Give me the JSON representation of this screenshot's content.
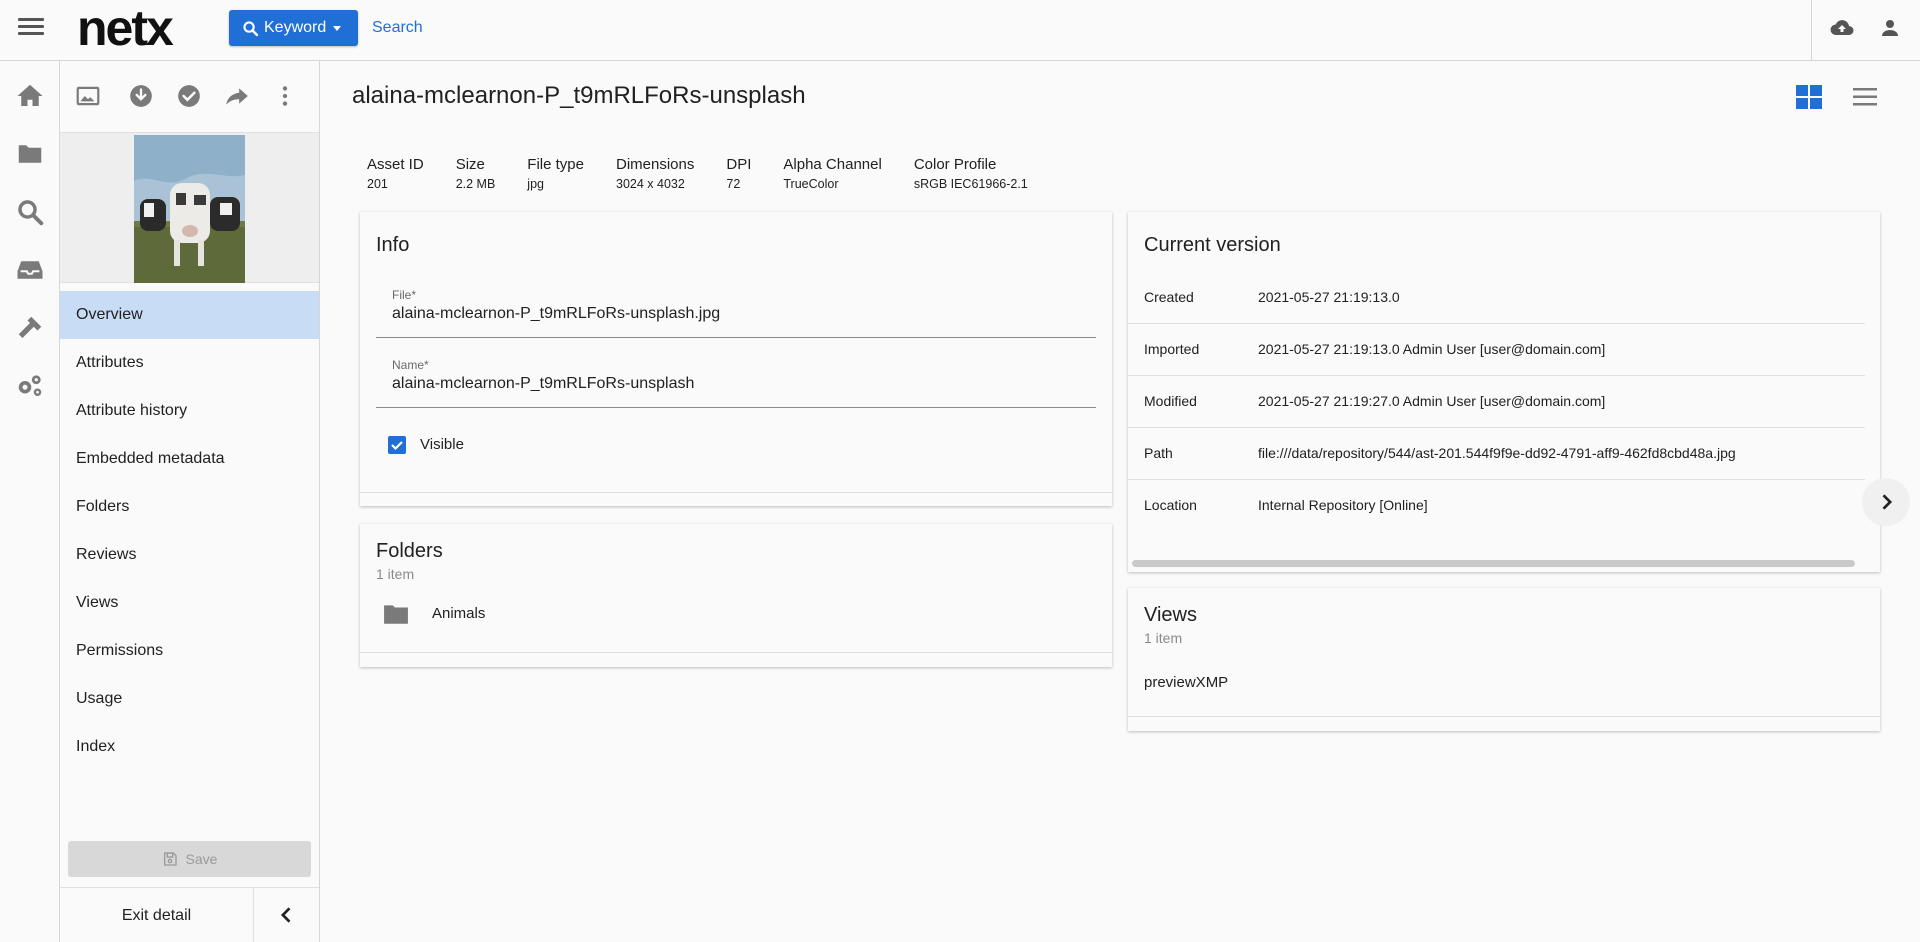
{
  "header": {
    "logo": "netx",
    "keyword_button": "Keyword",
    "search_placeholder": "Search"
  },
  "rail": {
    "icons": [
      "home-icon",
      "folder-icon",
      "search-icon",
      "inbox-icon",
      "hammer-icon",
      "gears-icon"
    ]
  },
  "sidepanel": {
    "toolbar_icons": [
      "image-icon",
      "download-icon",
      "check-circle-icon",
      "share-icon",
      "more-vert-icon"
    ],
    "nav": [
      {
        "label": "Overview",
        "active": true
      },
      {
        "label": "Attributes"
      },
      {
        "label": "Attribute history"
      },
      {
        "label": "Embedded metadata"
      },
      {
        "label": "Folders"
      },
      {
        "label": "Reviews"
      },
      {
        "label": "Views"
      },
      {
        "label": "Permissions"
      },
      {
        "label": "Usage"
      },
      {
        "label": "Index"
      }
    ],
    "save_label": "Save",
    "exit_label": "Exit detail"
  },
  "main": {
    "title": "alaina-mclearnon-P_t9mRLFoRs-unsplash",
    "meta": [
      {
        "label": "Asset ID",
        "value": "201"
      },
      {
        "label": "Size",
        "value": "2.2 MB"
      },
      {
        "label": "File type",
        "value": "jpg"
      },
      {
        "label": "Dimensions",
        "value": "3024 x 4032"
      },
      {
        "label": "DPI",
        "value": "72"
      },
      {
        "label": "Alpha Channel",
        "value": "TrueColor"
      },
      {
        "label": "Color Profile",
        "value": "sRGB IEC61966-2.1"
      }
    ],
    "info": {
      "title": "Info",
      "file_label": "File*",
      "file_value": "alaina-mclearnon-P_t9mRLFoRs-unsplash.jpg",
      "name_label": "Name*",
      "name_value": "alaina-mclearnon-P_t9mRLFoRs-unsplash",
      "visible_label": "Visible",
      "visible_checked": true
    },
    "folders": {
      "title": "Folders",
      "count": "1 item",
      "items": [
        "Animals"
      ]
    },
    "current_version": {
      "title": "Current version",
      "rows": [
        {
          "key": "Created",
          "value": "2021-05-27 21:19:13.0"
        },
        {
          "key": "Imported",
          "value": "2021-05-27 21:19:13.0 Admin User [user@domain.com]"
        },
        {
          "key": "Modified",
          "value": "2021-05-27 21:19:27.0 Admin User [user@domain.com]"
        },
        {
          "key": "Path",
          "value": "file:///data/repository/544/ast-201.544f9f9e-dd92-4791-aff9-462fd8cbd48a.jpg"
        },
        {
          "key": "Location",
          "value": "Internal Repository [Online]"
        }
      ]
    },
    "views": {
      "title": "Views",
      "count": "1 item",
      "items": [
        "previewXMP"
      ]
    }
  },
  "colors": {
    "accent": "#1f6fd6",
    "active_nav": "#c9dcf5"
  }
}
